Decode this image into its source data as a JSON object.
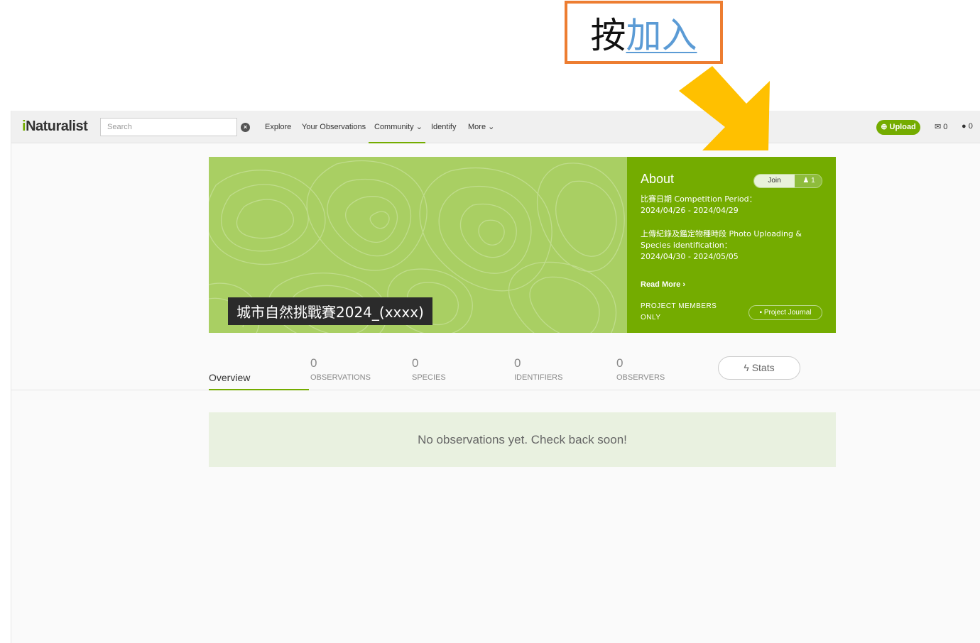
{
  "annotation": {
    "prefix": "按",
    "link": "加入"
  },
  "header": {
    "logo_i": "i",
    "logo_rest": "Naturalist",
    "search_placeholder": "Search",
    "nav": {
      "explore": "Explore",
      "your_observations": "Your Observations",
      "community": "Community",
      "identify": "Identify",
      "more": "More"
    },
    "upload_label": "Upload",
    "messages_count": "0",
    "notifications_count": "0"
  },
  "project": {
    "title": "城市自然挑戰賽2024_(xxxx)",
    "about_heading": "About",
    "join_label": "Join",
    "members_count": "1",
    "about_line1": "比賽日期 Competition Period：",
    "about_line2": "2024/04/26 - 2024/04/29",
    "about_line3": "上傳紀錄及鑑定物種時段 Photo Uploading & Species identification：",
    "about_line4": "2024/04/30 - 2024/05/05",
    "read_more": "Read More",
    "members_only": "PROJECT MEMBERS ONLY",
    "journal_label": "Project Journal"
  },
  "stats": {
    "overview_tab": "Overview",
    "observations_count": "0",
    "observations_label": "OBSERVATIONS",
    "species_count": "0",
    "species_label": "SPECIES",
    "identifiers_count": "0",
    "identifiers_label": "IDENTIFIERS",
    "observers_count": "0",
    "observers_label": "OBSERVERS",
    "stats_button": "Stats"
  },
  "empty_message": "No observations yet. Check back soon!",
  "colors": {
    "brand_green": "#74ac00",
    "banner_green": "#a9cf63",
    "callout_border": "#ed7d31",
    "callout_link": "#5b9bd5",
    "arrow_yellow": "#ffc000"
  }
}
